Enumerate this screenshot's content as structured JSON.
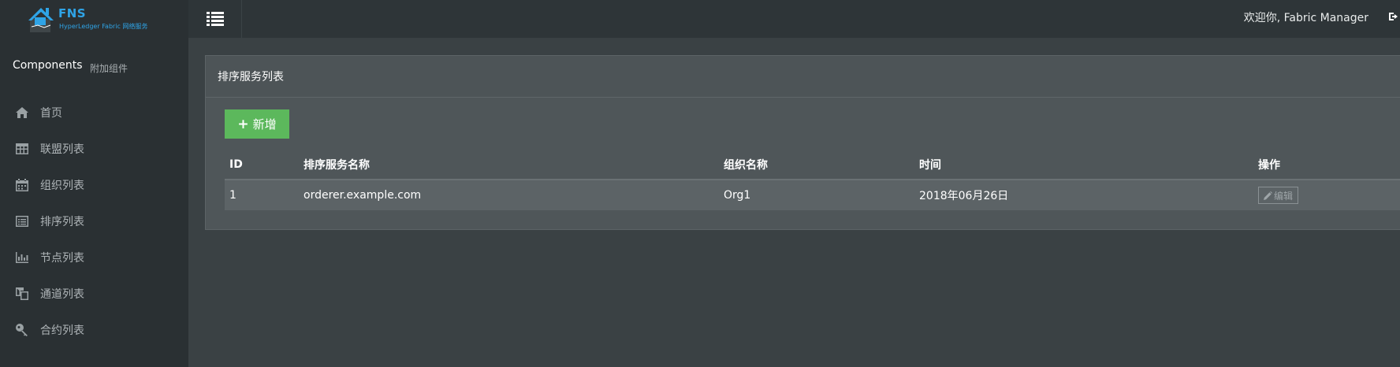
{
  "brand": {
    "name": "FNS",
    "subtitle": "HyperLedger Fabric 网络服务",
    "color": "#2fa4e7"
  },
  "sidebar": {
    "title": "Components",
    "subtitle": "附加组件",
    "items": [
      {
        "label": "首页",
        "icon": "home-icon"
      },
      {
        "label": "联盟列表",
        "icon": "table-icon"
      },
      {
        "label": "组织列表",
        "icon": "calendar-icon"
      },
      {
        "label": "排序列表",
        "icon": "list-alt-icon"
      },
      {
        "label": "节点列表",
        "icon": "bar-chart-icon"
      },
      {
        "label": "通道列表",
        "icon": "copy-icon"
      },
      {
        "label": "合约列表",
        "icon": "key-icon"
      }
    ]
  },
  "header": {
    "welcome": "欢迎你, Fabric Manager",
    "menu_icon": "list-icon",
    "logout_icon": "sign-out-icon"
  },
  "panel": {
    "title": "排序服务列表",
    "add_button": "新增",
    "table": {
      "columns": [
        "ID",
        "排序服务名称",
        "组织名称",
        "时间",
        "操作"
      ],
      "rows": [
        {
          "id": "1",
          "name": "orderer.example.com",
          "org": "Org1",
          "time": "2018年06月26日",
          "action": "编辑"
        }
      ]
    }
  },
  "colors": {
    "success": "#5cb85c",
    "sidebar_bg": "#2a3033",
    "panel_bg": "#4f5659"
  }
}
